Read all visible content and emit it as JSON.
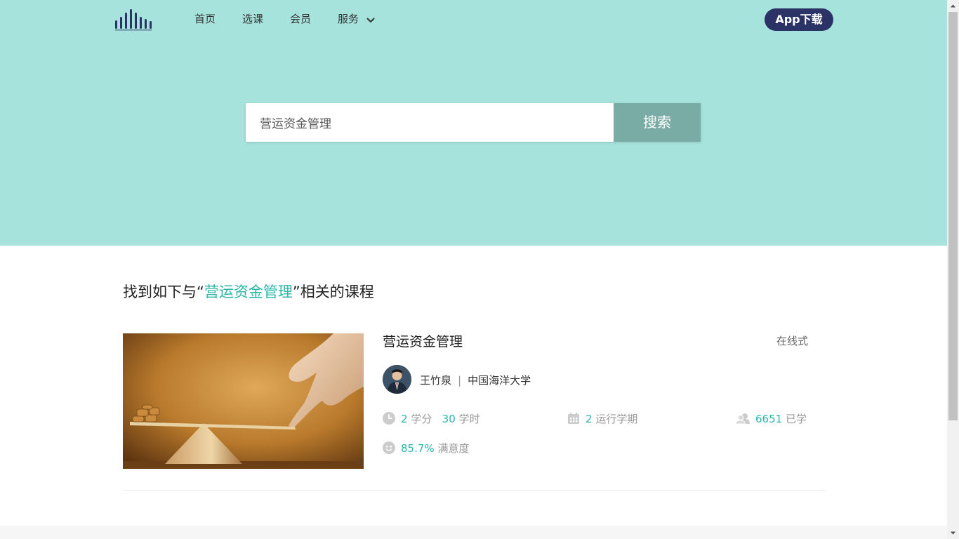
{
  "nav": {
    "logo_icon": "bars-logo-icon",
    "items": [
      {
        "label": "首页"
      },
      {
        "label": "选课"
      },
      {
        "label": "会员"
      },
      {
        "label": "服务",
        "icon": "chevron-down-icon"
      }
    ],
    "app_download": "App下载"
  },
  "search": {
    "value": "营运资金管理",
    "button_label": "搜索"
  },
  "results": {
    "heading_prefix": "找到如下与“",
    "heading_query": "营运资金管理",
    "heading_suffix": "”相关的课程",
    "courses": [
      {
        "title": "营运资金管理",
        "mode": "在线式",
        "teacher": "王竹泉",
        "school": "中国海洋大学",
        "credits": "2",
        "credits_unit": "学分",
        "hours": "30",
        "hours_unit": "学时",
        "terms": "2",
        "terms_unit": "运行学期",
        "learners": "6651",
        "learners_unit": "已学",
        "satisfaction": "85.7%",
        "satisfaction_unit": "满意度"
      }
    ]
  },
  "colors": {
    "hero_bg": "#a6e3dc",
    "accent": "#2bb5a8",
    "app_button_bg": "#2b3266",
    "search_button_bg": "#7aaca6"
  }
}
